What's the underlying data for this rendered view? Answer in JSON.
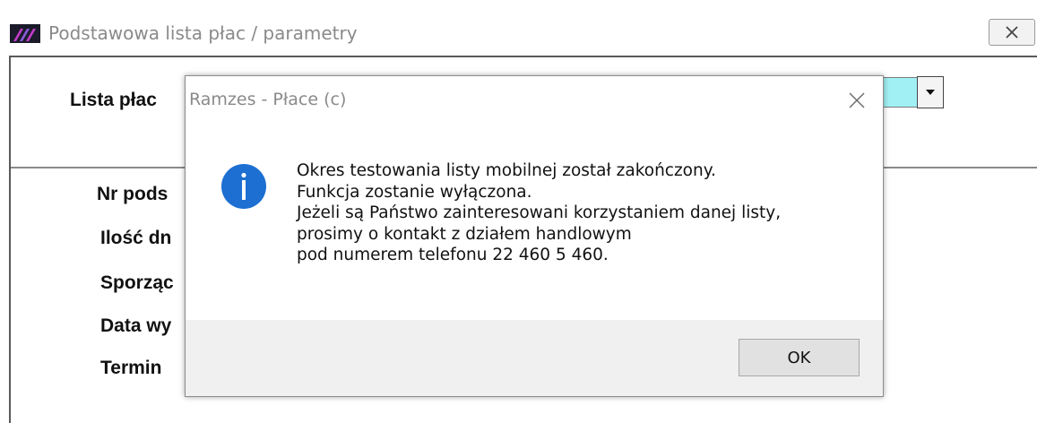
{
  "parent_window": {
    "title": "Podstawowa lista płac / parametry",
    "close_icon": "close-x-icon",
    "app_icon": "ramzes-app-icon"
  },
  "form": {
    "lista_label": "Lista płac",
    "fields": [
      {
        "label": "Nr pods"
      },
      {
        "label": "Ilość dn"
      },
      {
        "label": "Sporząc"
      },
      {
        "label": "Data wy"
      },
      {
        "label": "Termin"
      }
    ],
    "combo": {
      "value": "",
      "color": "#a0f0f4"
    }
  },
  "dialog": {
    "title": "Ramzes - Płace (c)",
    "icon": "info-icon",
    "message_lines": [
      "Okres testowania listy mobilnej został zakończony.",
      "Funkcja zostanie wyłączona.",
      "Jeżeli są Państwo zainteresowani korzystaniem danej listy,",
      "prosimy o kontakt z działem handlowym",
      "pod numerem telefonu 22 460 5 460."
    ],
    "ok_label": "OK"
  },
  "colors": {
    "info_blue": "#1d6fd1",
    "combo_cyan": "#a0f0f4",
    "footer_gray": "#f0f0f0"
  }
}
